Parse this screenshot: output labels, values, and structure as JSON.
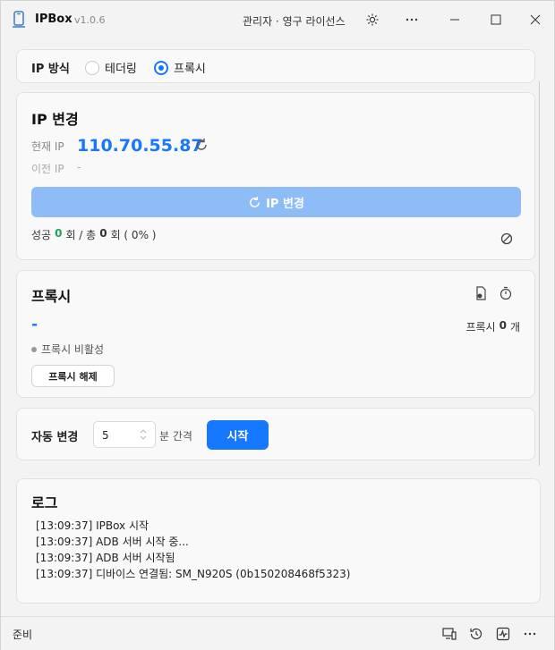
{
  "app": {
    "title": "IPBox",
    "version": "v1.0.6",
    "license": "관리자 · 영구 라이선스"
  },
  "ip_mode": {
    "label": "IP 방식",
    "options": [
      {
        "label": "테더링",
        "selected": false
      },
      {
        "label": "프록시",
        "selected": true
      }
    ]
  },
  "ip_change": {
    "title": "IP 변경",
    "current_label": "현재 IP",
    "current_value": "110.70.55.87",
    "previous_label": "이전 IP",
    "previous_value": "-",
    "button_label": "IP 변경",
    "stats_prefix": "성공",
    "success_count": "0",
    "stats_mid": "회 / 총",
    "total_count": "0",
    "stats_suffix": "회 ( 0% )"
  },
  "proxy": {
    "title": "프록시",
    "value": "-",
    "count_label": "프록시",
    "count": "0",
    "count_unit": "개",
    "status": "프록시 비활성",
    "release_button": "프록시 해제"
  },
  "auto_change": {
    "label": "자동 변경",
    "interval_value": "5",
    "interval_unit": "분 간격",
    "start_button": "시작"
  },
  "log": {
    "title": "로그",
    "lines": [
      "[13:09:37] IPBox 시작",
      "[13:09:37] ADB 서버 시작 중...",
      "[13:09:37] ADB 서버 시작됨",
      "[13:09:37] 디바이스 연결됨: SM_N920S (0b150208468f5323)"
    ]
  },
  "status_bar": {
    "text": "준비"
  },
  "colors": {
    "accent": "#1677ff",
    "ip_button_disabled": "#8dbcf7",
    "success": "#19a463"
  }
}
